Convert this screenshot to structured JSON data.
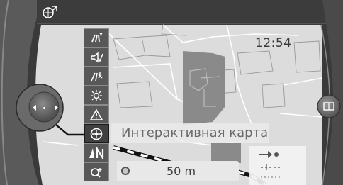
{
  "status": {
    "time": "12:54"
  },
  "tooltip": {
    "label": "Интерактивная карта"
  },
  "scale": {
    "value": "50 m"
  },
  "topbar": {
    "icon": "navigation-target-icon"
  },
  "menu": {
    "items": [
      {
        "icon": "traffic-info-icon"
      },
      {
        "icon": "voice-output-icon"
      },
      {
        "icon": "route-settings-icon"
      },
      {
        "icon": "points-of-interest-icon"
      },
      {
        "icon": "warning-icon"
      },
      {
        "icon": "interactive-map-icon",
        "selected": true
      },
      {
        "icon": "map-orientation-north-icon"
      },
      {
        "icon": "zoom-in-icon"
      }
    ]
  },
  "route_info": {
    "icons": [
      "arrow-right-icon",
      "dashed-route-icon"
    ]
  },
  "controller": {
    "icons": [
      "arrow-left-icon",
      "arrow-right-icon"
    ]
  },
  "right_button": {
    "icon": "screen-toggle-icon"
  },
  "colors": {
    "frame": "#3d3d3d",
    "map_background": "#dcdcdc",
    "map_block": "#8a8a8a",
    "menu_item": "#585858"
  }
}
